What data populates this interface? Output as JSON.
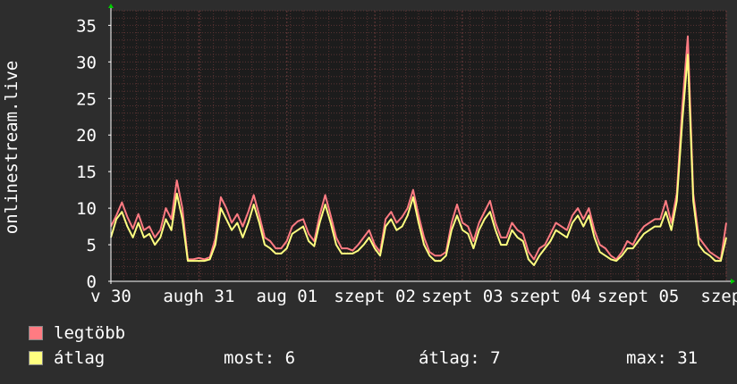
{
  "chart_data": {
    "type": "line",
    "ylabel": "onlinestream.live",
    "ylim": [
      0,
      37
    ],
    "yticks": [
      0,
      5,
      10,
      15,
      20,
      25,
      30,
      35
    ],
    "xlim": [
      0,
      100
    ],
    "xtick_labels": [
      "v 30",
      "augh 31",
      "aug 01",
      "szept 02",
      "szept 03",
      "szept 04",
      "szept 05",
      "szept"
    ],
    "xtick_positions": [
      0,
      14.3,
      28.6,
      42.9,
      57.1,
      71.4,
      85.7,
      100
    ],
    "grid": true,
    "series": [
      {
        "name": "legtöbb",
        "color": "#ff7b82",
        "values": [
          7.5,
          9,
          10.8,
          8.8,
          7.2,
          9.2,
          7,
          7.5,
          6,
          7,
          10,
          8.5,
          13.8,
          10,
          3,
          3,
          3.2,
          3,
          3.3,
          5.8,
          11.5,
          10,
          8,
          9.2,
          7.5,
          9.5,
          11.8,
          9,
          6,
          5.5,
          4.5,
          4.5,
          5.5,
          7.5,
          8.2,
          8.5,
          6.5,
          5.5,
          9,
          11.8,
          9,
          6,
          4.5,
          4.5,
          4.2,
          5,
          6,
          7,
          5,
          4,
          8.5,
          9.5,
          8,
          8.8,
          10,
          12.5,
          9,
          6,
          4,
          3.5,
          3.5,
          4,
          8,
          10.5,
          8,
          7.5,
          5.5,
          8,
          9.5,
          11,
          8,
          6,
          6,
          8,
          7,
          6.5,
          4,
          3,
          4.5,
          5,
          6.5,
          8,
          7.5,
          7,
          9,
          10,
          8.5,
          10,
          7,
          5,
          4.5,
          3.5,
          3,
          4,
          5.5,
          5,
          6.5,
          7.5,
          8,
          8.5,
          8.5,
          11,
          8,
          12,
          24,
          33.5,
          12,
          6,
          5,
          4,
          3.5,
          3,
          8
        ]
      },
      {
        "name": "átlag",
        "color": "#ffff80",
        "values": [
          6,
          8.5,
          9.5,
          7.5,
          6,
          8,
          6,
          6.5,
          5,
          6,
          8.5,
          7,
          12,
          8.5,
          2.8,
          2.8,
          2.8,
          2.8,
          3,
          5,
          10,
          8.5,
          7,
          8,
          6,
          8,
          10.5,
          8,
          5,
          4.5,
          3.8,
          3.8,
          4.5,
          6.5,
          7,
          7.5,
          5.5,
          4.8,
          8,
          10.5,
          8,
          5,
          3.8,
          3.8,
          3.8,
          4.2,
          5,
          6,
          4.5,
          3.5,
          7.5,
          8.5,
          7,
          7.5,
          9,
          11.5,
          8,
          5,
          3.5,
          2.8,
          2.8,
          3.5,
          7,
          9,
          7,
          6.5,
          4.5,
          7,
          8.5,
          9.5,
          7,
          5,
          5,
          7,
          6,
          5.5,
          3,
          2.2,
          3.5,
          4.5,
          5.5,
          7,
          6.5,
          6,
          8,
          9,
          7.5,
          9,
          6,
          4,
          3.5,
          3,
          2.8,
          3.5,
          4.5,
          4.5,
          5.5,
          6.5,
          7,
          7.5,
          7.5,
          9.5,
          7,
          11,
          22,
          31,
          11,
          5,
          4,
          3.5,
          2.8,
          2.8,
          6
        ]
      }
    ],
    "stats": [
      {
        "label": "most: 6"
      },
      {
        "label": "átlag: 7"
      },
      {
        "label": "max: 31"
      }
    ]
  },
  "colors": {
    "background": "#2d2d2d",
    "plot_area": "#1c1c1c",
    "grid": "#5a3333",
    "grid_major": "#6a3a3a",
    "axis": "#ffffff",
    "arrow": "#00cc00"
  }
}
